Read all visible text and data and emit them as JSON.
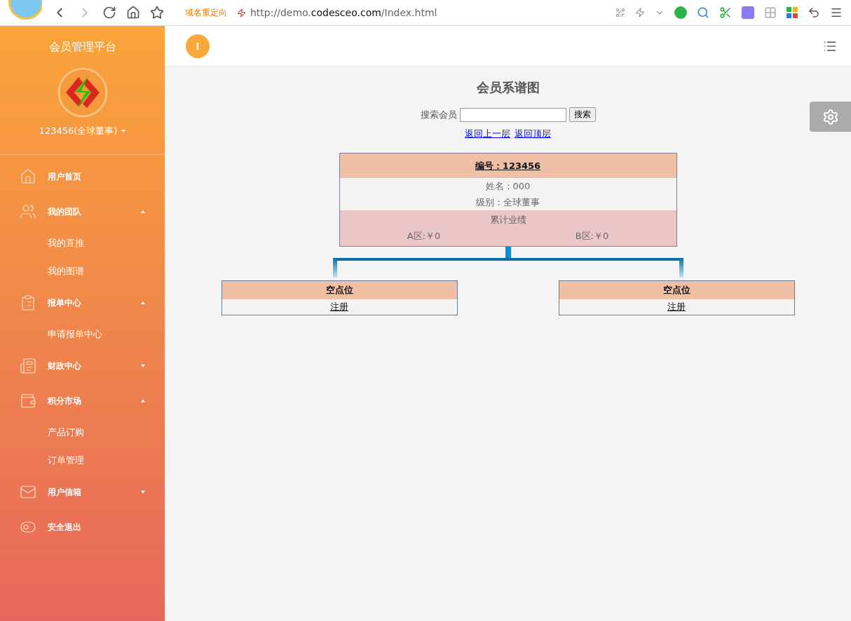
{
  "browser": {
    "redirect_label": "域名重定向",
    "url_prefix": "http://demo.",
    "url_domain": "codesceo.com",
    "url_path": "/Index.html"
  },
  "sidebar": {
    "title": "会员管理平台",
    "user": "123456(全球董事)",
    "items": [
      {
        "label": "用户首页",
        "kind": "link"
      },
      {
        "label": "我的团队",
        "kind": "group",
        "expanded": true,
        "children": [
          {
            "label": "我的直推"
          },
          {
            "label": "我的图谱"
          }
        ]
      },
      {
        "label": "报单中心",
        "kind": "group",
        "expanded": true,
        "children": [
          {
            "label": "申请报单中心"
          }
        ]
      },
      {
        "label": "财政中心",
        "kind": "group",
        "expanded": false
      },
      {
        "label": "积分市场",
        "kind": "group",
        "expanded": true,
        "children": [
          {
            "label": "产品订购"
          },
          {
            "label": "订单管理"
          }
        ]
      },
      {
        "label": "用户信箱",
        "kind": "group",
        "expanded": false
      },
      {
        "label": "安全退出",
        "kind": "link"
      }
    ]
  },
  "header": {
    "alert": "!"
  },
  "page": {
    "title": "会员系谱图",
    "search_label": "搜索会员",
    "search_button": "搜索",
    "links": [
      "返回上一层",
      "返回顶层"
    ]
  },
  "tree": {
    "root": {
      "id": "编号：123456",
      "lines": [
        "姓名：000",
        "级别：全球董事"
      ],
      "performance_title": "累计业绩",
      "zone_a": "A区:￥0",
      "zone_b": "B区:￥0"
    },
    "children": [
      {
        "title": "空点位",
        "action": "注册"
      },
      {
        "title": "空点位",
        "action": "注册"
      }
    ]
  }
}
